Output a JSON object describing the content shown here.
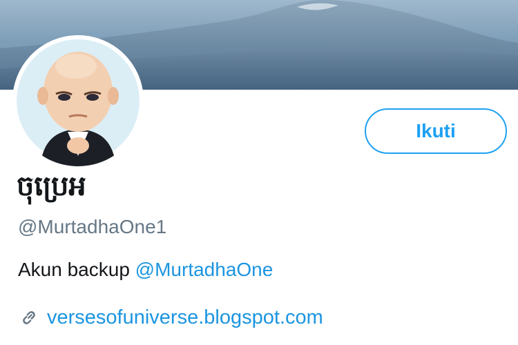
{
  "profile": {
    "display_name": "ចុប្រេអ",
    "handle": "@MurtadhaOne1",
    "bio_text": "Akun backup",
    "bio_mention": "@MurtadhaOne",
    "website": "versesofuniverse.blogspot.com"
  },
  "actions": {
    "follow_label": "Ikuti"
  },
  "icons": {
    "website": "link-icon"
  },
  "colors": {
    "accent": "#1da1f2",
    "link": "#1b95e0",
    "text_primary": "#14171a",
    "text_secondary": "#657786"
  }
}
